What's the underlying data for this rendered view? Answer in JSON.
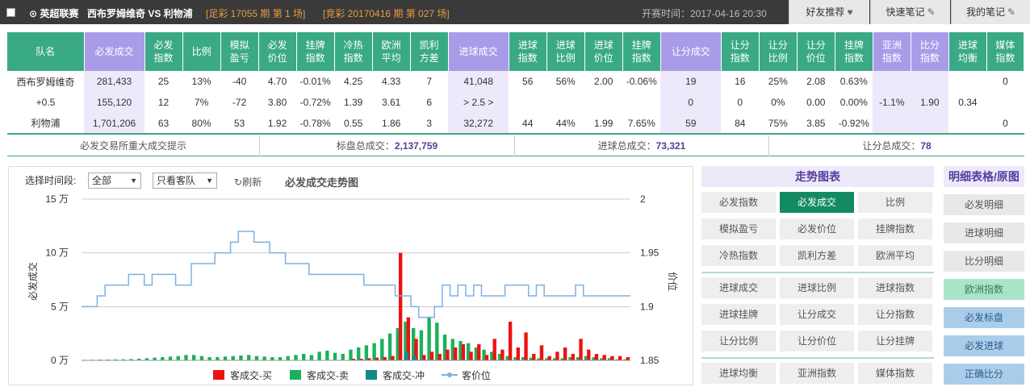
{
  "topbar": {
    "league": "⊙ 英超联赛",
    "teams": "西布罗姆维奇  VS  利物浦",
    "zucai": "[足彩 17055 期 第 1 场]",
    "jingcai": "[竞彩 20170416 期 第 027 场]",
    "kickoff": "开赛时间：2017-04-16 20:30",
    "btn_recommend": "好友推荐",
    "btn_quicknote": "快速笔记",
    "btn_mynote": "我的笔记"
  },
  "table": {
    "headers": [
      "队名",
      "必发成交",
      "必发指数",
      "比例",
      "模拟盈亏",
      "必发价位",
      "挂牌指数",
      "冷热指数",
      "欧洲平均",
      "凯利方差",
      "进球成交",
      "进球指数",
      "进球比例",
      "进球价位",
      "挂牌指数",
      "让分成交",
      "让分指数",
      "让分比例",
      "让分价位",
      "挂牌指数",
      "亚洲指数",
      "比分指数",
      "进球均衡",
      "媒体指数"
    ],
    "rows": [
      [
        "西布罗姆维奇",
        "281,433",
        "25",
        "13%",
        "-40",
        "4.70",
        "-0.01%",
        "4.25",
        "4.33",
        "7",
        "41,048",
        "56",
        "56%",
        "2.00",
        "-0.06%",
        "19",
        "16",
        "25%",
        "2.08",
        "0.63%",
        "",
        "",
        "",
        "0"
      ],
      [
        "+0.5",
        "155,120",
        "12",
        "7%",
        "-72",
        "3.80",
        "-0.72%",
        "1.39",
        "3.61",
        "6",
        "> 2.5 >",
        "",
        "",
        "",
        "",
        "0",
        "0",
        "0%",
        "0.00",
        "0.00%",
        "-1.1%",
        "1.90",
        "0.34",
        ""
      ],
      [
        "利物浦",
        "1,701,206",
        "63",
        "80%",
        "53",
        "1.92",
        "-0.78%",
        "0.55",
        "1.86",
        "3",
        "32,272",
        "44",
        "44%",
        "1.99",
        "7.65%",
        "59",
        "84",
        "75%",
        "3.85",
        "-0.92%",
        "",
        "",
        "",
        "0"
      ]
    ]
  },
  "summary": {
    "hint": "必发交易所重大成交提示",
    "total_label": "标盘总成交：",
    "total_value": "2,137,759",
    "goal_label": "进球总成交：",
    "goal_value": "73,321",
    "handicap_label": "让分总成交：",
    "handicap_value": "78"
  },
  "chart_controls": {
    "period_label": "选择时间段:",
    "period_value": "全部",
    "view_value": "只看客队",
    "refresh": "刷新",
    "title": "必发成交走势图"
  },
  "chart_data": {
    "type": "bar",
    "ylabel": "必发成交",
    "y2label": "价位",
    "ylim": [
      0,
      150000
    ],
    "y2lim": [
      1.85,
      2
    ],
    "yticks": [
      "15 万",
      "10 万",
      "5 万",
      "0 万"
    ],
    "y2ticks": [
      "2",
      "1.95",
      "1.9",
      "1.85"
    ],
    "legend": [
      "客成交-买",
      "客成交-卖",
      "客成交-冲",
      "客价位"
    ],
    "colors": {
      "buy": "#ee1111",
      "sell": "#19b25a",
      "hedge": "#138a8a",
      "price": "#7fb0e0"
    },
    "price_series": [
      1.9,
      1.9,
      1.91,
      1.92,
      1.92,
      1.92,
      1.93,
      1.93,
      1.92,
      1.93,
      1.93,
      1.93,
      1.92,
      1.92,
      1.94,
      1.94,
      1.94,
      1.95,
      1.95,
      1.96,
      1.97,
      1.97,
      1.96,
      1.96,
      1.95,
      1.95,
      1.94,
      1.94,
      1.94,
      1.93,
      1.93,
      1.93,
      1.93,
      1.93,
      1.93,
      1.93,
      1.92,
      1.92,
      1.92,
      1.92,
      1.91,
      1.91,
      1.9,
      1.89,
      1.89,
      1.9,
      1.92,
      1.91,
      1.92,
      1.91,
      1.92,
      1.91,
      1.91,
      1.91,
      1.92,
      1.92,
      1.92,
      1.91,
      1.92,
      1.91,
      1.91,
      1.91,
      1.91,
      1.92,
      1.91,
      1.91,
      1.91,
      1.91,
      1.91,
      1.91
    ],
    "buy_series": [
      0,
      0,
      0,
      0,
      0,
      0,
      0,
      0,
      0,
      0,
      0,
      0,
      0,
      0,
      0,
      0,
      0,
      0,
      0,
      0,
      0,
      0,
      0,
      0,
      0,
      0,
      0,
      0,
      0,
      0,
      0,
      0,
      0,
      0,
      1500,
      1500,
      2000,
      2500,
      3000,
      4000,
      100000,
      40000,
      20000,
      5000,
      8000,
      6000,
      10000,
      12000,
      15000,
      8000,
      15000,
      5000,
      20000,
      10000,
      36000,
      12000,
      26000,
      6000,
      14000,
      4000,
      8000,
      12000,
      6000,
      20000,
      10000,
      6000,
      5000,
      4000,
      4000,
      3000
    ],
    "sell_series": [
      500,
      600,
      700,
      800,
      900,
      1000,
      1200,
      1500,
      2000,
      2500,
      3000,
      3500,
      4000,
      5000,
      5000,
      4000,
      3000,
      3000,
      3500,
      4000,
      4500,
      5000,
      4000,
      3500,
      3000,
      3000,
      4000,
      5000,
      6000,
      5000,
      8000,
      9000,
      7000,
      6000,
      10000,
      12000,
      14000,
      16000,
      20000,
      25000,
      30000,
      36000,
      30000,
      28000,
      40000,
      35000,
      24000,
      20000,
      18000,
      16000,
      12000,
      10000,
      8000,
      6000,
      4000,
      3000,
      3000,
      2500,
      2000,
      2000,
      2000,
      2000,
      3000,
      3000,
      4000,
      3000,
      2000,
      2000,
      1000,
      1000
    ],
    "hedge_series": [
      0,
      0,
      0,
      0,
      0,
      0,
      0,
      0,
      0,
      0,
      0,
      0,
      0,
      0,
      0,
      0,
      0,
      0,
      0,
      0,
      0,
      0,
      0,
      0,
      0,
      0,
      0,
      0,
      0,
      0,
      0,
      0,
      0,
      0,
      0,
      0,
      0,
      0,
      0,
      0,
      0,
      8000,
      4000,
      0,
      0,
      0,
      0,
      0,
      0,
      0,
      0,
      0,
      0,
      0,
      0,
      0,
      0,
      0,
      0,
      0,
      0,
      0,
      0,
      0,
      0,
      0,
      0,
      0,
      0,
      0
    ]
  },
  "trend_panel": {
    "title": "走势图表",
    "buttons": [
      "必发指数",
      "必发成交",
      "比例",
      "模拟盈亏",
      "必发价位",
      "挂牌指数",
      "冷热指数",
      "凯利方差",
      "欧洲平均",
      "进球成交",
      "进球比例",
      "进球指数",
      "进球挂牌",
      "让分成交",
      "让分指数",
      "让分比例",
      "让分价位",
      "让分挂牌",
      "进球均衡",
      "亚洲指数",
      "媒体指数"
    ],
    "active": "必发成交"
  },
  "detail_panel": {
    "title": "明细表格/原图",
    "buttons": [
      "必发明细",
      "进球明细",
      "比分明细",
      "欧洲指数",
      "必发标盘",
      "必发进球",
      "正确比分"
    ]
  }
}
